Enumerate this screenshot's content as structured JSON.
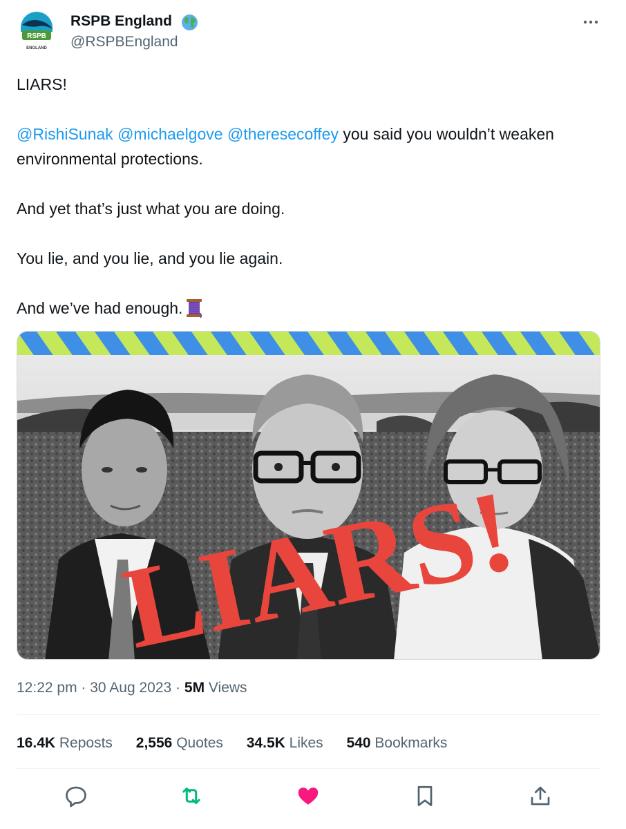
{
  "author": {
    "display_name": "RSPB England",
    "handle": "@RSPBEngland",
    "avatar_text_top": "RSPB",
    "avatar_text_bottom": "ENGLAND",
    "verified_badge_icon": "globe-icon"
  },
  "tweet": {
    "line_1": "LIARS!",
    "mentions": [
      "@RishiSunak",
      "@michaelgove",
      "@theresecoffey"
    ],
    "line_2_rest": " you said you wouldn’t weaken environmental protections.",
    "line_3": "And yet that’s just what you are doing.",
    "line_4": "You lie, and you lie, and you lie again.",
    "line_5": "And we’ve had enough.",
    "emoji_icon": "thread-spool-icon"
  },
  "media": {
    "overlay_text": "LIARS!",
    "colors": {
      "stripe_blue": "#3f8fe6",
      "stripe_green": "#c4e85a",
      "overlay_red": "#e8463c"
    }
  },
  "meta": {
    "time": "12:22 pm",
    "separator": "·",
    "date": "30 Aug 2023",
    "views_count": "5M",
    "views_label": "Views"
  },
  "stats": {
    "reposts_count": "16.4K",
    "reposts_label": "Reposts",
    "quotes_count": "2,556",
    "quotes_label": "Quotes",
    "likes_count": "34.5K",
    "likes_label": "Likes",
    "bookmarks_count": "540",
    "bookmarks_label": "Bookmarks"
  },
  "actions": [
    "reply-icon",
    "repost-icon",
    "like-icon",
    "bookmark-icon",
    "share-icon"
  ],
  "colors": {
    "link": "#1d9bf0",
    "secondary_text": "#536471",
    "repost_green": "#00ba7c",
    "like_pink": "#f91880"
  }
}
